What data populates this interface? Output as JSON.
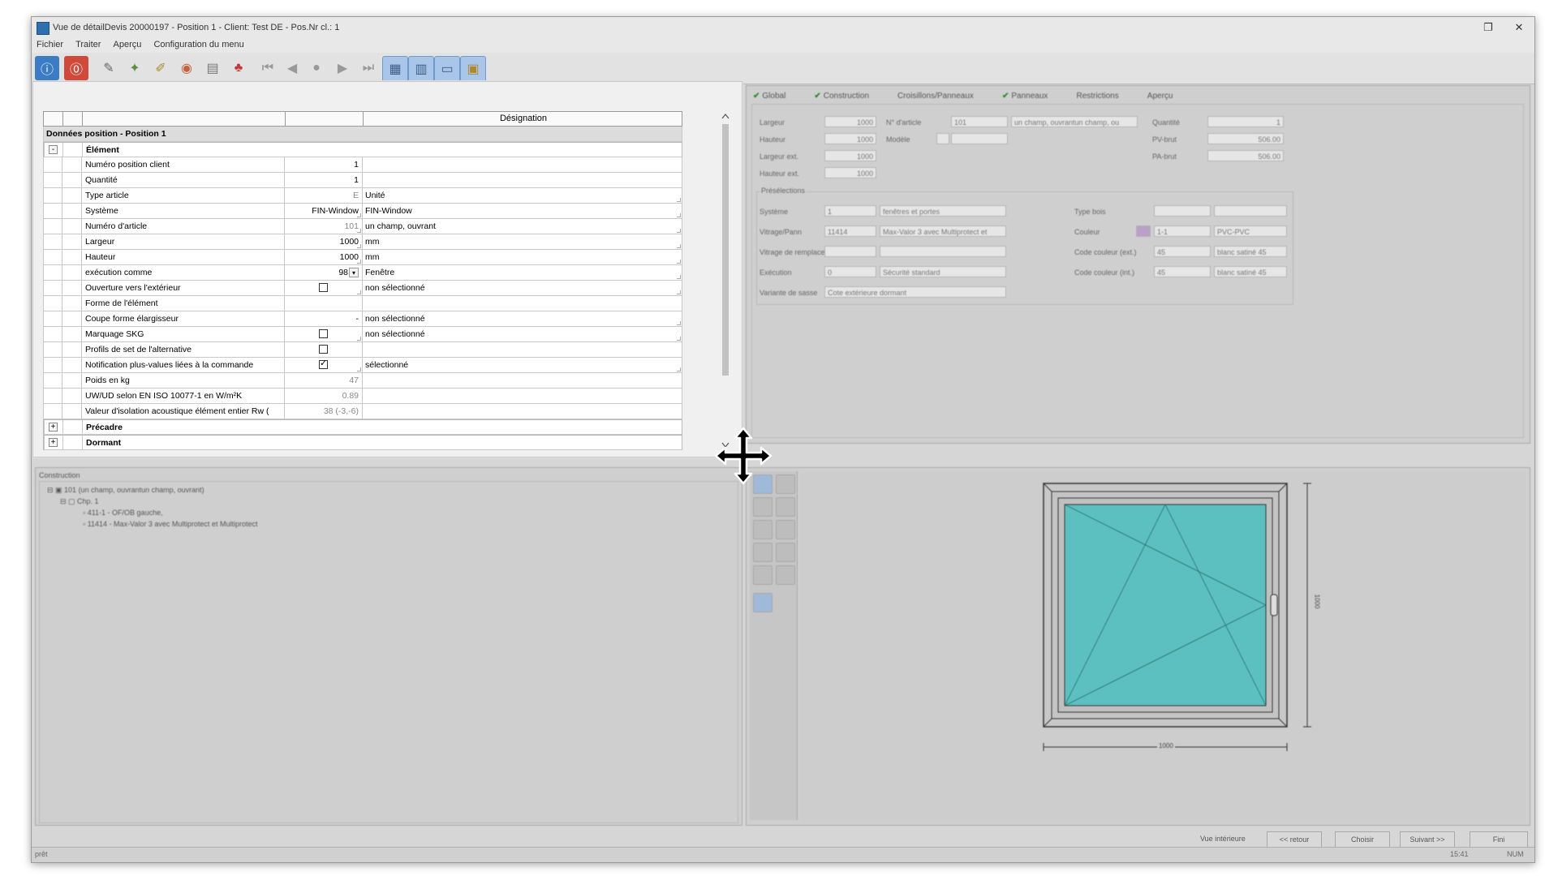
{
  "window": {
    "title": "Vue de détailDevis 20000197 - Position 1 - Client: Test DE - Pos.Nr cl.: 1",
    "menu": [
      "Fichier",
      "Traiter",
      "Aperçu",
      "Configuration du menu"
    ]
  },
  "grid": {
    "header": {
      "designation": "Désignation"
    },
    "section_title": "Données position - Position 1",
    "group_element": "Élément",
    "rows": [
      {
        "label": "Numéro position client",
        "value": "1",
        "designation": ""
      },
      {
        "label": "Quantité",
        "value": "1",
        "designation": ""
      },
      {
        "label": "Type article",
        "value": "E",
        "designation": "Unité"
      },
      {
        "label": "Système",
        "value": "FIN-Window",
        "designation": "FIN-Window"
      },
      {
        "label": "Numéro d'article",
        "value": "101",
        "designation": "un champ, ouvrant"
      },
      {
        "label": "Largeur",
        "value": "1000",
        "designation": "mm"
      },
      {
        "label": "Hauteur",
        "value": "1000",
        "designation": "mm"
      },
      {
        "label": "exécution comme",
        "value": "98",
        "designation": "Fenêtre"
      },
      {
        "label": "Ouverture vers l'extérieur",
        "value": "",
        "designation": "non sélectionné"
      },
      {
        "label": "Forme de l'élément",
        "value": "",
        "designation": ""
      },
      {
        "label": "Coupe forme élargisseur",
        "value": "-",
        "designation": "non sélectionné"
      },
      {
        "label": "Marquage SKG",
        "value": "",
        "designation": "non sélectionné"
      },
      {
        "label": "Profils de set de l'alternative",
        "value": "",
        "designation": ""
      },
      {
        "label": "Notification plus-values liées à la commande",
        "value": "",
        "designation": "sélectionné"
      },
      {
        "label": "Poids en kg",
        "value": "47",
        "designation": ""
      },
      {
        "label": "UW/UD selon EN ISO 10077-1 en W/m²K",
        "value": "0.89",
        "designation": ""
      },
      {
        "label": "Valeur d'isolation acoustique élément entier Rw (",
        "value": "38 (-3,-6)",
        "designation": ""
      }
    ],
    "group_precadre": "Précadre",
    "group_dormant": "Dormant"
  },
  "right_tabs": [
    "Global",
    "Construction",
    "Croisillons/Panneaux",
    "Panneaux",
    "Restrictions",
    "Aperçu"
  ],
  "global": {
    "largeur_label": "Largeur",
    "largeur": "1000",
    "hauteur_label": "Hauteur",
    "hauteur": "1000",
    "largeur_ext_label": "Largeur ext.",
    "largeur_ext": "1000",
    "hauteur_ext_label": "Hauteur ext.",
    "hauteur_ext": "1000",
    "article_label": "N° d'article",
    "article": "101",
    "article_desc": "un champ, ouvrantun champ, ou",
    "modele_label": "Modèle",
    "quantite_label": "Quantité",
    "quantite": "1",
    "pv_label": "PV-brut",
    "pv": "506.00",
    "pa_label": "PA-brut",
    "pa": "506.00",
    "preselections_label": "Présélections",
    "systeme_label": "Système",
    "systeme": "1",
    "systeme_desc": "fenêtres et portes",
    "vitrage_label": "Vitrage/Pann",
    "vitrage": "11414",
    "vitrage_desc": "Max-Valor 3 avec Multiprotect et",
    "vitrage_remplace_label": "Vitrage de remplace",
    "execution_label": "Exécution",
    "execution": "0",
    "execution_desc": "Sécurité standard",
    "variante_label": "Variante de sasse",
    "variante": "Cote extérieure dormant",
    "typebois_label": "Type bois",
    "couleur_label": "Couleur",
    "couleur": "1-1",
    "couleur_desc": "PVC-PVC",
    "code_ext_label": "Code couleur (ext.)",
    "code_ext": "45",
    "code_ext_desc": "blanc satiné 45",
    "code_int_label": "Code couleur (int.)",
    "code_int": "45",
    "code_int_desc": "blanc satiné 45"
  },
  "construction": {
    "title": "Construction",
    "tree": [
      "101 (un champ, ouvrantun champ, ouvrant)",
      "Chp. 1",
      "411-1 - OF/OB gauche,",
      "11414 - Max-Valor 3 avec Multiprotect et Multiprotect"
    ]
  },
  "drawing": {
    "width_dim": "1000",
    "height_dim": "1000",
    "glass_color": "#5bc0bf"
  },
  "footer": {
    "vue_interieure": "Vue intérieure",
    "retour": "<< retour",
    "choisir": "Choisir",
    "suivant": "Suivant >>",
    "fini": "Fini"
  },
  "status": {
    "left": "prêt",
    "time": "15:41",
    "num": "NUM"
  }
}
